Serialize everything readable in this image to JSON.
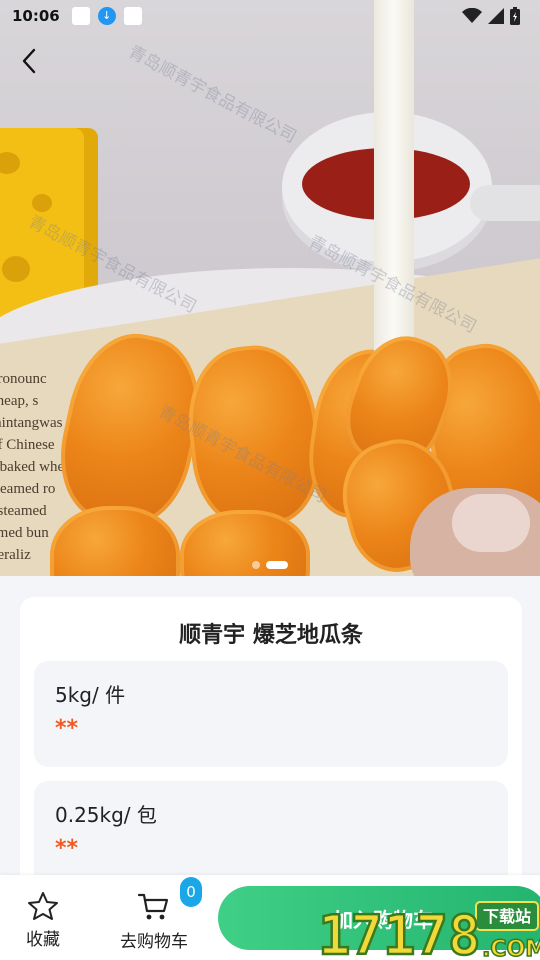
{
  "status_bar": {
    "time": "10:06"
  },
  "navigation": {
    "back_icon": "chevron-left-icon"
  },
  "hero": {
    "paper_lines": [
      "pronounc",
      "cheap, s",
      "mintangwas",
      "of Chinese",
      "s baked whe",
      "steamed ro",
      ", steamed",
      "amed bun",
      "neraliz"
    ],
    "watermark_text": "青岛顺青宇食品有限公司",
    "carousel": {
      "total": 2,
      "active": 2
    }
  },
  "product": {
    "title": "顺青宇 爆芝地瓜条",
    "specs": [
      {
        "name": "5kg/ 件",
        "price": "**"
      },
      {
        "name": "0.25kg/ 包",
        "price": "**"
      }
    ]
  },
  "bottom_bar": {
    "favorite_label": "收藏",
    "favorite_icon": "star-outline-icon",
    "cart_label": "去购物车",
    "cart_icon": "shopping-cart-icon",
    "cart_count": "0",
    "add_to_cart_label": "加入购物车"
  },
  "overlay_logo": {
    "number": "17178",
    "suffix": ".COM",
    "tag": "下载站"
  },
  "colors": {
    "price": "#f05a22",
    "primary_button": "#2bbd77",
    "badge": "#1aa7e8"
  }
}
